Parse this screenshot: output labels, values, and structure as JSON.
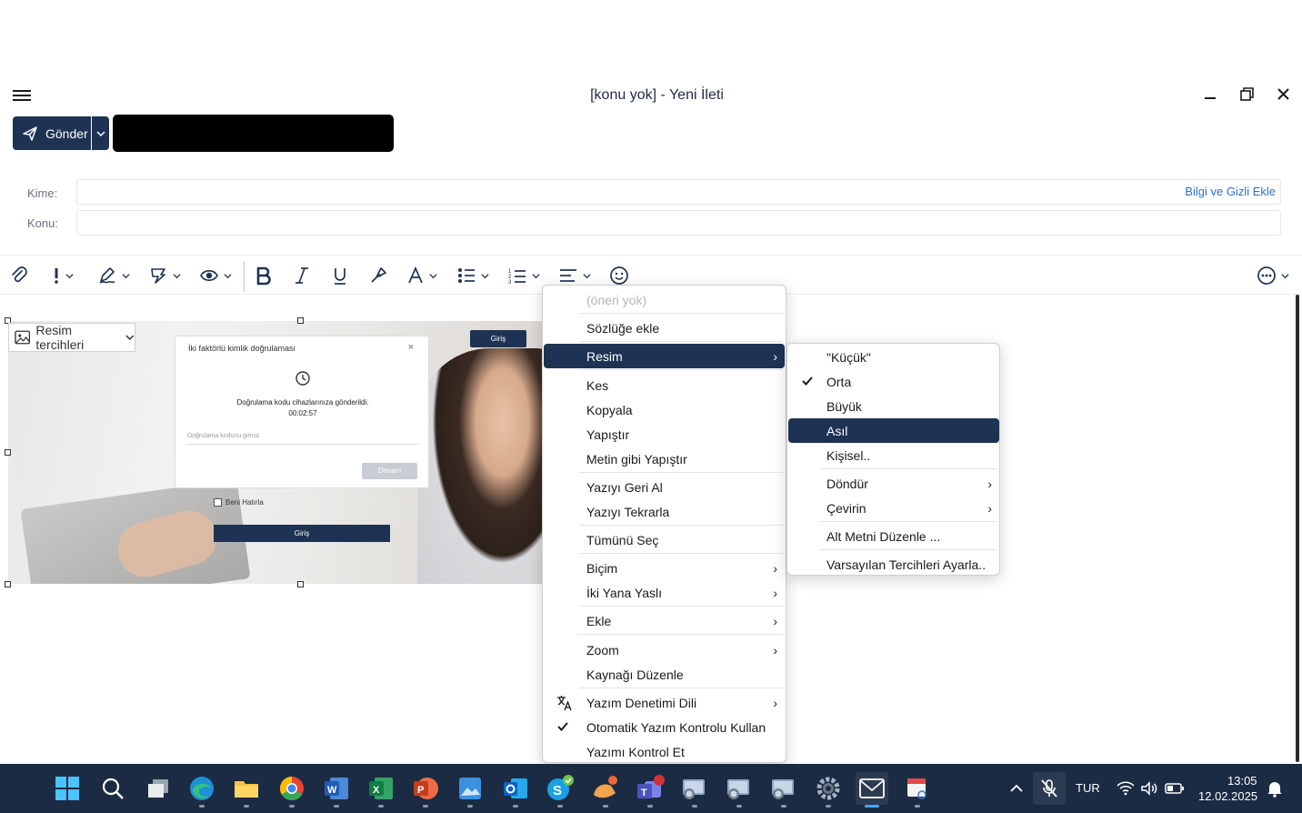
{
  "window": {
    "title": "[konu yok] - Yeni İleti"
  },
  "toolbar_top": {
    "send_label": "Gönder"
  },
  "fields": {
    "to_label": "Kime:",
    "subject_label": "Konu:",
    "cc_bcc_label": "Bilgi ve Gizli Ekle",
    "to_value": "",
    "subject_value": ""
  },
  "format_toolbar": {
    "icons": [
      "paperclip-icon",
      "importance-icon",
      "signature-icon",
      "sensitivity-icon",
      "visibility-icon",
      "bold-icon",
      "italic-icon",
      "underline-icon",
      "format-painter-icon",
      "font-icon",
      "bullet-list-icon",
      "numbered-list-icon",
      "align-icon",
      "emoji-icon",
      "more-options-icon"
    ]
  },
  "image": {
    "prefs_label": "Resim tercihleri",
    "dialog_title": "İki faktörlü kimlik doğrulaması",
    "dialog_close": "×",
    "dialog_message": "Doğrulama kodu cihazlarınıza gönderildi.",
    "dialog_timer": "00:02:57",
    "dialog_input_placeholder": "Doğrulama kodunu giriniz",
    "dialog_button": "Devam",
    "login_top": "Giriş",
    "remember_me": "Beni Hatırla",
    "login_bottom": "Giriş"
  },
  "context_menu": {
    "items": [
      {
        "label": "(öneri yok)"
      },
      {
        "label": "Sözlüğe ekle"
      },
      {
        "label": "Resim"
      },
      {
        "label": "Kes"
      },
      {
        "label": "Kopyala"
      },
      {
        "label": "Yapıştır"
      },
      {
        "label": "Metin gibi Yapıştır"
      },
      {
        "label": "Yazıyı Geri Al"
      },
      {
        "label": "Yazıyı Tekrarla"
      },
      {
        "label": "Tümünü Seç"
      },
      {
        "label": "Biçim"
      },
      {
        "label": "İki Yana Yaslı"
      },
      {
        "label": "Ekle"
      },
      {
        "label": "Zoom"
      },
      {
        "label": "Kaynağı Düzenle"
      },
      {
        "label": "Yazım Denetimi Dili"
      },
      {
        "label": "Otomatik Yazım Kontrolu Kullan"
      },
      {
        "label": "Yazımı Kontrol Et"
      }
    ]
  },
  "submenu": {
    "items": [
      {
        "label": "\"Küçük\""
      },
      {
        "label": "Orta"
      },
      {
        "label": "Büyük"
      },
      {
        "label": "Asıl"
      },
      {
        "label": "Kişisel.."
      },
      {
        "label": "Döndür"
      },
      {
        "label": "Çevirin"
      },
      {
        "label": "Alt Metni Düzenle ..."
      },
      {
        "label": "Varsayılan Tercihleri Ayarla.."
      }
    ]
  },
  "taskbar": {
    "apps": [
      "windows-start-icon",
      "search-icon",
      "task-view-icon",
      "edge-icon",
      "file-explorer-icon",
      "chrome-icon",
      "word-icon",
      "excel-icon",
      "powerpoint-icon",
      "photos-icon",
      "outlook-icon",
      "skype-icon",
      "app-icon",
      "teams-icon",
      "remote-desktop-icon",
      "remote-desktop-icon-2",
      "remote-desktop-icon-3",
      "settings-icon",
      "mail-icon",
      "snipping-tool-icon"
    ],
    "language": "TUR",
    "time": "13:05",
    "date": "12.02.2025"
  },
  "colors": {
    "accent": "#1e3354",
    "taskbar": "#1c2b44",
    "link": "#2f6fc4"
  }
}
